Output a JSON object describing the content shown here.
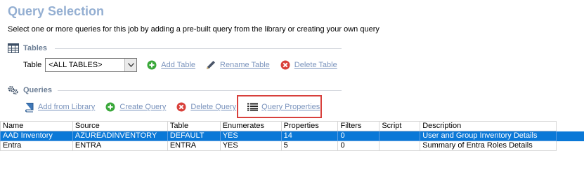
{
  "header": {
    "title": "Query Selection",
    "subtitle": "Select one or more queries for this job by adding a pre-built query from the library or creating your own query"
  },
  "tables_section": {
    "heading": "Tables",
    "table_label": "Table",
    "table_select_value": "<ALL TABLES>",
    "actions": {
      "add": "Add Table",
      "rename": "Rename Table",
      "delete": "Delete Table"
    }
  },
  "queries_section": {
    "heading": "Queries",
    "actions": {
      "add_from_library": "Add from Library",
      "create": "Create Query",
      "delete": "Delete Query",
      "properties": "Query Properties"
    }
  },
  "grid": {
    "columns": [
      "Name",
      "Source",
      "Table",
      "Enumerates",
      "Properties",
      "Filters",
      "Script",
      "Description"
    ],
    "rows": [
      {
        "name": "AAD Inventory",
        "source": "AZUREADINVENTORY",
        "table": "DEFAULT",
        "enumerates": "YES",
        "properties": "14",
        "filters": "0",
        "script": "",
        "description": "User and Group Inventory Details",
        "selected": true
      },
      {
        "name": "Entra",
        "source": "ENTRA",
        "table": "ENTRA",
        "enumerates": "YES",
        "properties": "5",
        "filters": "0",
        "script": "",
        "description": "Summary of Entra Roles Details",
        "selected": false
      }
    ]
  },
  "colors": {
    "title": "#94afd2",
    "link": "#7b94bd",
    "selection": "#0a78d7",
    "highlight_border": "#d8403c",
    "add_icon": "#3aa83a",
    "delete_icon": "#d9403a"
  }
}
